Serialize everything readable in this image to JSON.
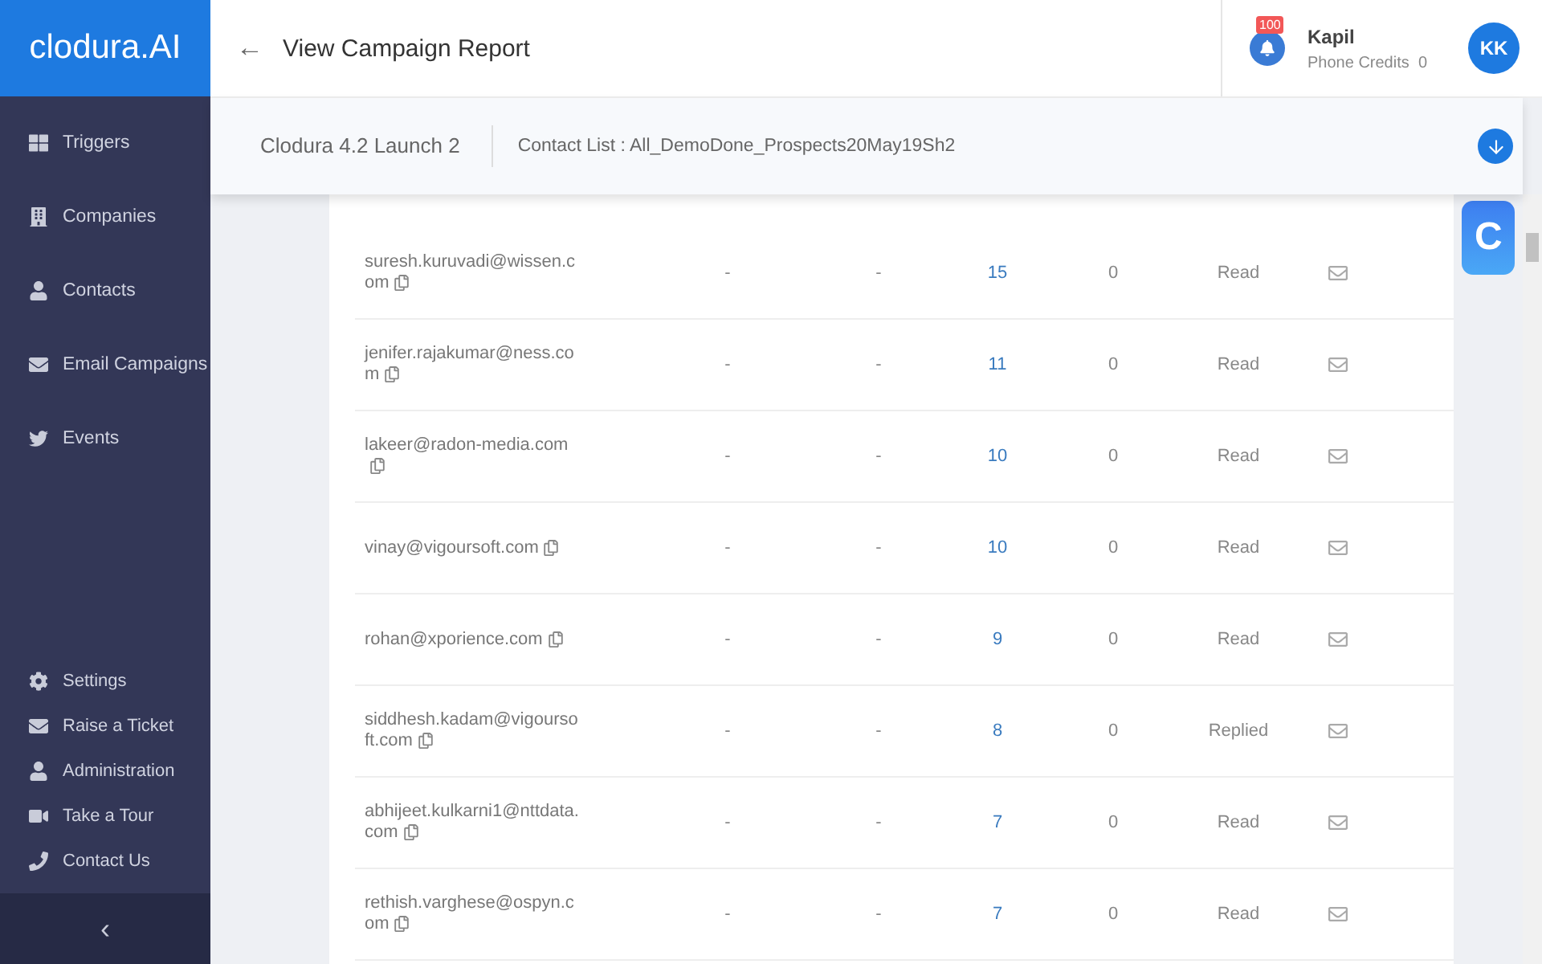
{
  "logo": "clodura.AI",
  "sidebar": {
    "items": [
      {
        "label": "Triggers"
      },
      {
        "label": "Companies"
      },
      {
        "label": "Contacts"
      },
      {
        "label": "Email Campaigns"
      },
      {
        "label": "Events"
      }
    ],
    "footer_items": [
      {
        "label": "Settings"
      },
      {
        "label": "Raise a Ticket"
      },
      {
        "label": "Administration"
      },
      {
        "label": "Take a Tour"
      },
      {
        "label": "Contact Us"
      }
    ],
    "collapse": "‹"
  },
  "header": {
    "back": "←",
    "title": "View Campaign Report",
    "notifications": "100",
    "user_name": "Kapil",
    "credits_label": "Phone Credits",
    "credits": "0",
    "avatar": "KK"
  },
  "subheader": {
    "campaign": "Clodura 4.2 Launch 2",
    "contact_list": "Contact List : All_DemoDone_Prospects20May19Sh2"
  },
  "widget": "C",
  "table": {
    "rows": [
      {
        "email": "suresh.kuruvadi@wissen.com",
        "column_2": "-",
        "column_3": "-",
        "count": "15",
        "column_5": "0",
        "status": "Read"
      },
      {
        "email": "jenifer.rajakumar@ness.com",
        "column_2": "-",
        "column_3": "-",
        "count": "11",
        "column_5": "0",
        "status": "Read"
      },
      {
        "email": "lakeer@radon-media.com",
        "column_2": "-",
        "column_3": "-",
        "count": "10",
        "column_5": "0",
        "status": "Read"
      },
      {
        "email": "vinay@vigoursoft.com",
        "column_2": "-",
        "column_3": "-",
        "count": "10",
        "column_5": "0",
        "status": "Read"
      },
      {
        "email": "rohan@xporience.com",
        "column_2": "-",
        "column_3": "-",
        "count": "9",
        "column_5": "0",
        "status": "Read"
      },
      {
        "email": "siddhesh.kadam@vigoursoft.com",
        "column_2": "-",
        "column_3": "-",
        "count": "8",
        "column_5": "0",
        "status": "Replied"
      },
      {
        "email": "abhijeet.kulkarni1@nttdata.com",
        "column_2": "-",
        "column_3": "-",
        "count": "7",
        "column_5": "0",
        "status": "Read"
      },
      {
        "email": "rethish.varghese@ospyn.com",
        "column_2": "-",
        "column_3": "-",
        "count": "7",
        "column_5": "0",
        "status": "Read"
      }
    ]
  }
}
